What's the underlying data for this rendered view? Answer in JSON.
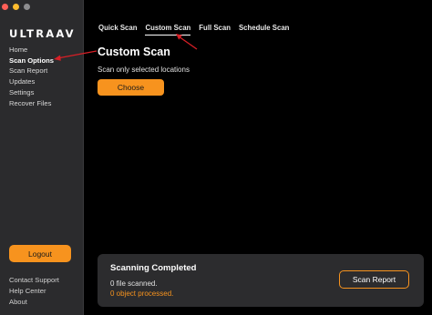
{
  "app": {
    "logo": "ULTRAAV"
  },
  "window": {
    "controls": {
      "close_color": "#ff5f57",
      "minimize_color": "#febc2e",
      "zoom_color": "#8e8e90"
    }
  },
  "sidebar": {
    "items": [
      {
        "label": "Home"
      },
      {
        "label": "Scan Options"
      },
      {
        "label": "Scan Report"
      },
      {
        "label": "Updates"
      },
      {
        "label": "Settings"
      },
      {
        "label": "Recover Files"
      }
    ],
    "logout_label": "Logout",
    "footer": [
      {
        "label": "Contact Support"
      },
      {
        "label": "Help Center"
      },
      {
        "label": "About"
      }
    ]
  },
  "tabs": [
    {
      "label": "Quick Scan"
    },
    {
      "label": "Custom Scan"
    },
    {
      "label": "Full Scan"
    },
    {
      "label": "Schedule Scan"
    }
  ],
  "main": {
    "title": "Custom Scan",
    "subtitle": "Scan only selected locations",
    "choose_label": "Choose"
  },
  "status": {
    "title": "Scanning Completed",
    "files": "0 file scanned.",
    "objects": "0 object processed.",
    "report_label": "Scan Report"
  },
  "colors": {
    "accent": "#f7931e",
    "annotation_arrow": "#d81f26",
    "sidebar_bg": "#2b2b2d",
    "card_bg": "#2c2c2e"
  }
}
